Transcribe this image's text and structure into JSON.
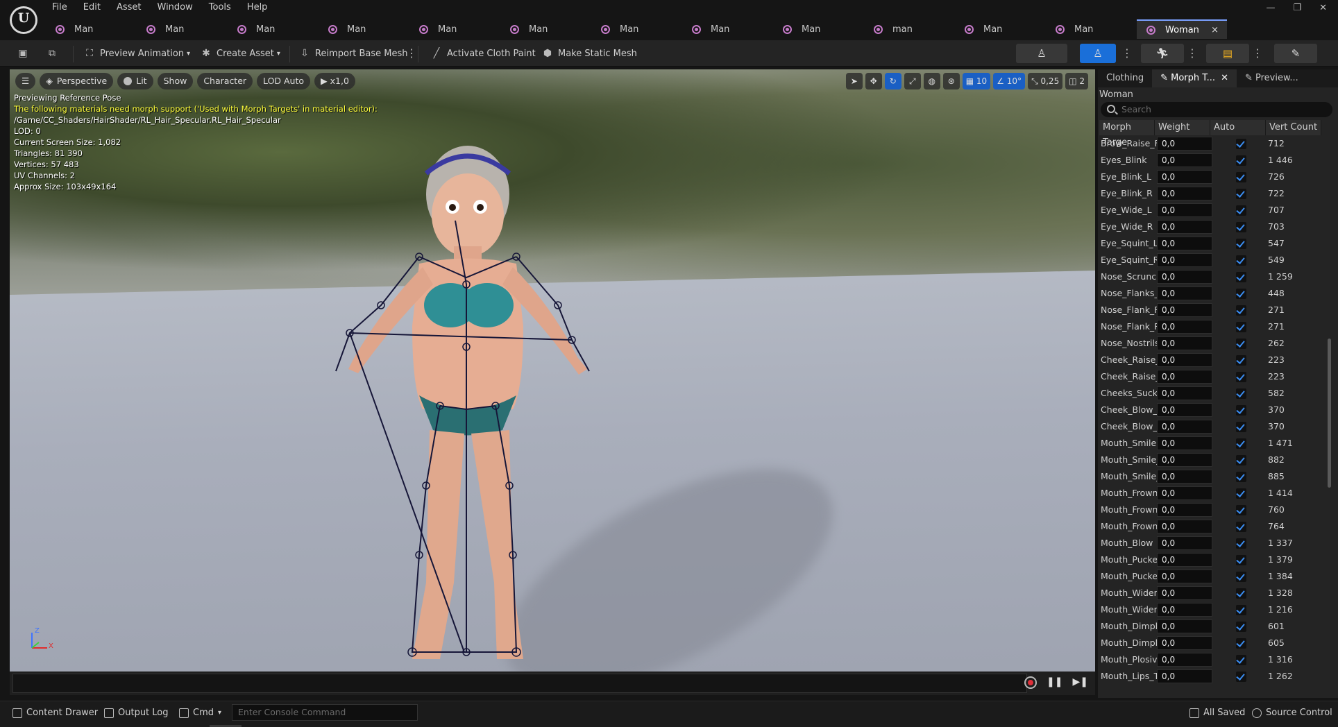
{
  "menu": [
    "File",
    "Edit",
    "Asset",
    "Window",
    "Tools",
    "Help"
  ],
  "window_controls": [
    "—",
    "❐",
    "✕"
  ],
  "tabs": [
    {
      "label": "Man"
    },
    {
      "label": "Man"
    },
    {
      "label": "Man"
    },
    {
      "label": "Man"
    },
    {
      "label": "Man"
    },
    {
      "label": "Man"
    },
    {
      "label": "Man"
    },
    {
      "label": "Man"
    },
    {
      "label": "Man"
    },
    {
      "label": "man"
    },
    {
      "label": "Man"
    },
    {
      "label": "Man"
    },
    {
      "label": "Woman",
      "active": true,
      "close": "×"
    }
  ],
  "toolbar": {
    "preview_animation": "Preview Animation",
    "create_asset": "Create Asset",
    "reimport_base_mesh": "Reimport Base Mesh",
    "activate_cloth_paint": "Activate Cloth Paint",
    "make_static_mesh": "Make Static Mesh"
  },
  "viewport": {
    "buttons": {
      "perspective": "Perspective",
      "lit": "Lit",
      "show": "Show",
      "character": "Character",
      "lod": "LOD Auto",
      "speed": "x1,0"
    },
    "right_tools": {
      "grid": "10",
      "rotation": "10°",
      "scale": "0,25",
      "camera_speed": "2"
    },
    "info": {
      "line1": "Previewing Reference Pose",
      "warning": "The following materials need morph support ('Used with Morph Targets' in material editor):",
      "material_path": "/Game/CC_Shaders/HairShader/RL_Hair_Specular.RL_Hair_Specular",
      "lod": "LOD: 0",
      "screen_size": "Current Screen Size: 1,082",
      "triangles": "Triangles: 81 390",
      "vertices": "Vertices: 57 483",
      "uv_channels": "UV Channels: 2",
      "approx_size": "Approx Size: 103x49x164"
    },
    "axis": {
      "z": "Z",
      "x": "X"
    }
  },
  "panel": {
    "tabs": [
      "Clothing",
      "Morph T...",
      "Preview..."
    ],
    "asset_name": "Woman",
    "search_placeholder": "Search",
    "columns": [
      "Morph Targe",
      "Weight",
      "Auto",
      "Vert Count"
    ],
    "rows": [
      {
        "name": "Brow_Raise_F",
        "weight": "0,0",
        "count": "712"
      },
      {
        "name": "Eyes_Blink",
        "weight": "0,0",
        "count": "1 446"
      },
      {
        "name": "Eye_Blink_L",
        "weight": "0,0",
        "count": "726"
      },
      {
        "name": "Eye_Blink_R",
        "weight": "0,0",
        "count": "722"
      },
      {
        "name": "Eye_Wide_L",
        "weight": "0,0",
        "count": "707"
      },
      {
        "name": "Eye_Wide_R",
        "weight": "0,0",
        "count": "703"
      },
      {
        "name": "Eye_Squint_L",
        "weight": "0,0",
        "count": "547"
      },
      {
        "name": "Eye_Squint_R",
        "weight": "0,0",
        "count": "549"
      },
      {
        "name": "Nose_Scruncl",
        "weight": "0,0",
        "count": "1 259"
      },
      {
        "name": "Nose_Flanks_",
        "weight": "0,0",
        "count": "448"
      },
      {
        "name": "Nose_Flank_R",
        "weight": "0,0",
        "count": "271"
      },
      {
        "name": "Nose_Flank_R",
        "weight": "0,0",
        "count": "271"
      },
      {
        "name": "Nose_Nostrils",
        "weight": "0,0",
        "count": "262"
      },
      {
        "name": "Cheek_Raise_",
        "weight": "0,0",
        "count": "223"
      },
      {
        "name": "Cheek_Raise_",
        "weight": "0,0",
        "count": "223"
      },
      {
        "name": "Cheeks_Suck",
        "weight": "0,0",
        "count": "582"
      },
      {
        "name": "Cheek_Blow_L",
        "weight": "0,0",
        "count": "370"
      },
      {
        "name": "Cheek_Blow_F",
        "weight": "0,0",
        "count": "370"
      },
      {
        "name": "Mouth_Smile",
        "weight": "0,0",
        "count": "1 471"
      },
      {
        "name": "Mouth_Smile_",
        "weight": "0,0",
        "count": "882"
      },
      {
        "name": "Mouth_Smile_",
        "weight": "0,0",
        "count": "885"
      },
      {
        "name": "Mouth_Frown",
        "weight": "0,0",
        "count": "1 414"
      },
      {
        "name": "Mouth_Frown_",
        "weight": "0,0",
        "count": "760"
      },
      {
        "name": "Mouth_Frown_",
        "weight": "0,0",
        "count": "764"
      },
      {
        "name": "Mouth_Blow",
        "weight": "0,0",
        "count": "1 337"
      },
      {
        "name": "Mouth_Pucker",
        "weight": "0,0",
        "count": "1 379"
      },
      {
        "name": "Mouth_Pucker",
        "weight": "0,0",
        "count": "1 384"
      },
      {
        "name": "Mouth_Widen",
        "weight": "0,0",
        "count": "1 328"
      },
      {
        "name": "Mouth_Widen_",
        "weight": "0,0",
        "count": "1 216"
      },
      {
        "name": "Mouth_Dimple",
        "weight": "0,0",
        "count": "601"
      },
      {
        "name": "Mouth_Dimple",
        "weight": "0,0",
        "count": "605"
      },
      {
        "name": "Mouth_Plosive",
        "weight": "0,0",
        "count": "1 316"
      },
      {
        "name": "Mouth_Lips_T",
        "weight": "0,0",
        "count": "1 262"
      }
    ]
  },
  "statusbar": {
    "content_drawer": "Content Drawer",
    "output_log": "Output Log",
    "cmd": "Cmd",
    "console_placeholder": "Enter Console Command",
    "all_saved": "All Saved",
    "source_control": "Source Control"
  },
  "colors": {
    "accent": "#1a6fd9",
    "warning": "#ffff3c",
    "checkbox": "#3a8cf0",
    "tab_icon": "#c57bc9"
  }
}
